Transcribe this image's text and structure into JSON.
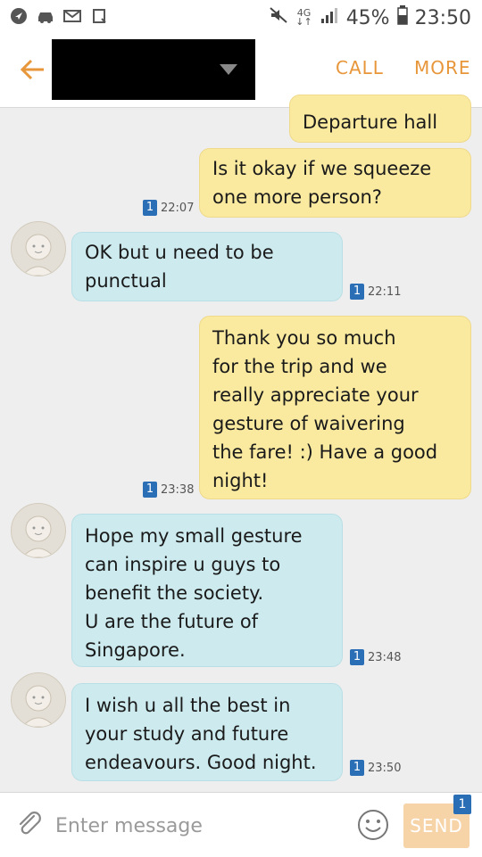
{
  "status_bar": {
    "network_top": "4G",
    "network_bottom": "↓↑",
    "battery": "45%",
    "time": "23:50"
  },
  "header": {
    "call_label": "CALL",
    "more_label": "MORE",
    "accent_color": "#e8963a"
  },
  "messages": [
    {
      "direction": "out",
      "text": "Departure hall"
    },
    {
      "direction": "out",
      "text": "Is it okay if we squeeze\none more person?",
      "unread": "1",
      "time": "22:07"
    },
    {
      "direction": "in",
      "text": "OK but u need to be\npunctual",
      "unread": "1",
      "time": "22:11"
    },
    {
      "direction": "out",
      "text": "Thank you so much\nfor the trip and we\nreally appreciate your\ngesture of waivering\nthe fare! :) Have a good\nnight!",
      "unread": "1",
      "time": "23:38"
    },
    {
      "direction": "in",
      "text": "Hope my small gesture\ncan inspire u guys to\nbenefit the society.\nU are the future of\nSingapore.",
      "unread": "1",
      "time": "23:48"
    },
    {
      "direction": "in",
      "text": "I wish u all the best in\nyour study and future\nendeavours. Good night.",
      "unread": "1",
      "time": "23:50"
    }
  ],
  "composer": {
    "placeholder": "Enter message",
    "send_label": "SEND",
    "send_badge": "1"
  }
}
